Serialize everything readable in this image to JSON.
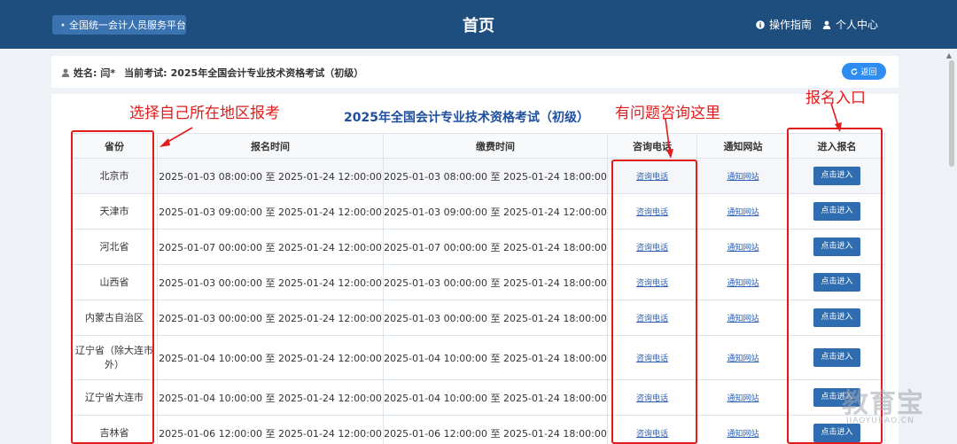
{
  "header": {
    "platform_label": "全国统一会计人员服务平台",
    "title": "首页",
    "guide_label": "操作指南",
    "personal_label": "个人中心"
  },
  "info_bar": {
    "name_label": "姓名:",
    "name_value": "闫*",
    "exam_label": "当前考试:",
    "exam_value": "2025年全国会计专业技术资格考试（初级）",
    "back_label": "返回"
  },
  "table": {
    "title": "2025年全国会计专业技术资格考试（初级）",
    "headers": [
      "省份",
      "报名时间",
      "缴费时间",
      "咨询电话",
      "通知网站",
      "进入报名"
    ],
    "phone_link": "咨询电话",
    "site_link": "通知网站",
    "enter_label": "点击进入",
    "rows": [
      {
        "province": "北京市",
        "reg_time": "2025-01-03 08:00:00 至 2025-01-24 12:00:00",
        "pay_time": "2025-01-03 08:00:00 至 2025-01-24 18:00:00"
      },
      {
        "province": "天津市",
        "reg_time": "2025-01-03 09:00:00 至 2025-01-24 12:00:00",
        "pay_time": "2025-01-03 09:00:00 至 2025-01-24 12:00:00"
      },
      {
        "province": "河北省",
        "reg_time": "2025-01-07 00:00:00 至 2025-01-24 12:00:00",
        "pay_time": "2025-01-07 00:00:00 至 2025-01-24 18:00:00"
      },
      {
        "province": "山西省",
        "reg_time": "2025-01-03 00:00:00 至 2025-01-24 12:00:00",
        "pay_time": "2025-01-03 00:00:00 至 2025-01-24 18:00:00"
      },
      {
        "province": "内蒙古自治区",
        "reg_time": "2025-01-03 00:00:00 至 2025-01-24 12:00:00",
        "pay_time": "2025-01-03 00:00:00 至 2025-01-24 18:00:00"
      },
      {
        "province": "辽宁省（除大连市外）",
        "reg_time": "2025-01-04 10:00:00 至 2025-01-24 12:00:00",
        "pay_time": "2025-01-04 10:00:00 至 2025-01-24 18:00:00"
      },
      {
        "province": "辽宁省大连市",
        "reg_time": "2025-01-04 10:00:00 至 2025-01-24 12:00:00",
        "pay_time": "2025-01-04 10:00:00 至 2025-01-24 18:00:00"
      },
      {
        "province": "吉林省",
        "reg_time": "2025-01-06 12:00:00 至 2025-01-24 12:00:00",
        "pay_time": "2025-01-06 12:00:00 至 2025-01-24 18:00:00"
      }
    ]
  },
  "annotations": {
    "select_region": "选择自己所在地区报考",
    "consult_here": "有问题咨询这里",
    "register_entry": "报名入口",
    "color": "#e21b1b"
  },
  "watermark": {
    "main": "教育宝",
    "sub": "JIAOYUBAO.CN"
  },
  "colors": {
    "header_bg": "#1e4e7e",
    "primary": "#2f6db0",
    "title_blue": "#1e4e9e"
  }
}
